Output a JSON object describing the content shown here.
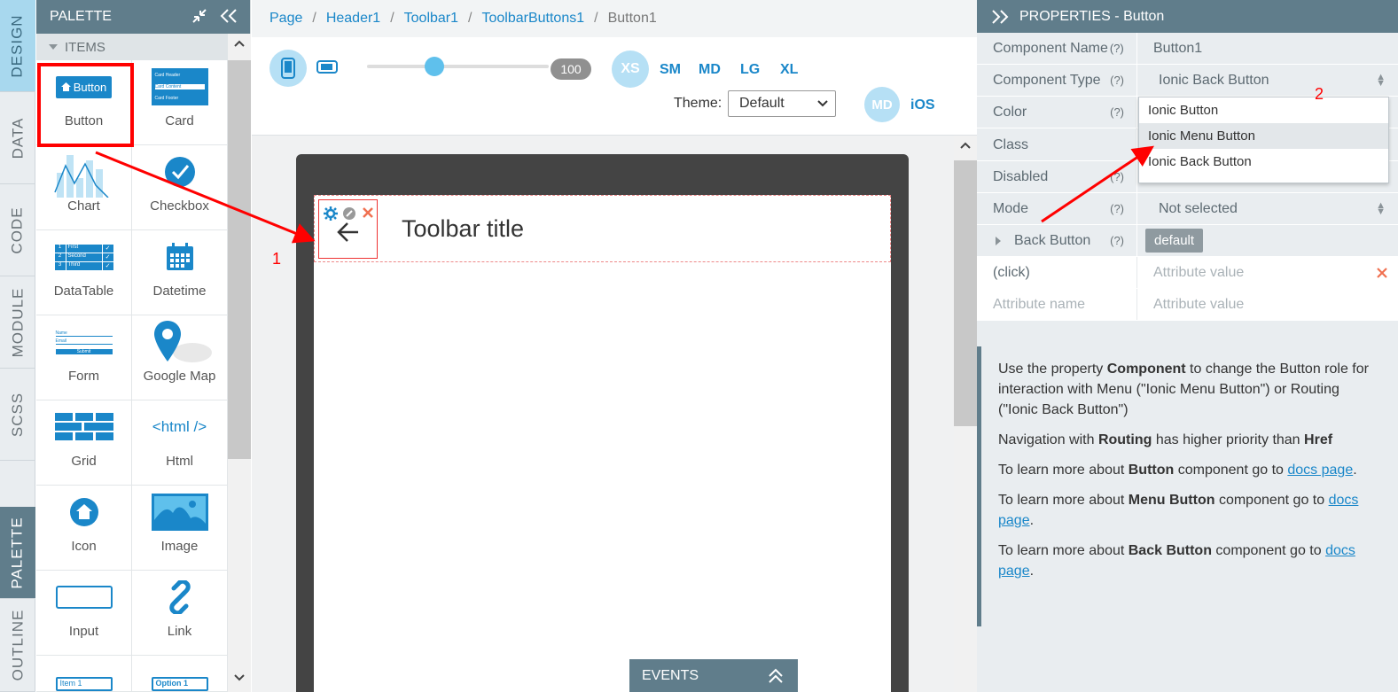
{
  "vtabs": {
    "design": "DESIGN",
    "data": "DATA",
    "code": "CODE",
    "module": "MODULE",
    "scss": "SCSS",
    "palette": "PALETTE",
    "outline": "OUTLINE"
  },
  "palette": {
    "title": "PALETTE",
    "section": "ITEMS",
    "items": [
      {
        "label": "Button",
        "icon": "button-icon"
      },
      {
        "label": "Card",
        "icon": "card-icon"
      },
      {
        "label": "Chart",
        "icon": "chart-icon"
      },
      {
        "label": "Checkbox",
        "icon": "checkbox-icon"
      },
      {
        "label": "DataTable",
        "icon": "datatable-icon"
      },
      {
        "label": "Datetime",
        "icon": "calendar-icon"
      },
      {
        "label": "Form",
        "icon": "form-icon"
      },
      {
        "label": "Google Map",
        "icon": "map-pin-icon"
      },
      {
        "label": "Grid",
        "icon": "grid-icon"
      },
      {
        "label": "Html",
        "icon": "html-icon"
      },
      {
        "label": "Icon",
        "icon": "home-icon"
      },
      {
        "label": "Image",
        "icon": "image-icon"
      },
      {
        "label": "Input",
        "icon": "input-icon"
      },
      {
        "label": "Link",
        "icon": "link-icon"
      }
    ],
    "button_icon_text": "Button",
    "card_lines": [
      "Card Header",
      "Card Content",
      "Card Footer"
    ],
    "datatable_rows": [
      [
        "1",
        "First"
      ],
      [
        "2",
        "Second"
      ],
      [
        "3",
        "Third"
      ]
    ],
    "form_lines": [
      "Name",
      "Email",
      "Submit"
    ],
    "html_text": "<html />",
    "partial_items": [
      "Item 1",
      "Option 1"
    ]
  },
  "breadcrumb": [
    "Page",
    "Header1",
    "Toolbar1",
    "ToolbarButtons1",
    "Button1"
  ],
  "toolbar": {
    "slider_value": "100",
    "breakpoints": [
      "XS",
      "SM",
      "MD",
      "LG",
      "XL"
    ],
    "theme_label": "Theme:",
    "theme_value": "Default",
    "modes": [
      "MD",
      "iOS"
    ]
  },
  "canvas": {
    "toolbar_title": "Toolbar title",
    "annotation_1": "1",
    "annotation_2": "2",
    "events_label": "EVENTS"
  },
  "properties": {
    "title": "PROPERTIES - Button",
    "help": "(?)",
    "rows": [
      {
        "label": "Component Name",
        "value": "Button1"
      },
      {
        "label": "Component Type",
        "value": "Ionic Back Button"
      },
      {
        "label": "Color",
        "value": ""
      },
      {
        "label": "Class",
        "value": ""
      },
      {
        "label": "Disabled",
        "value": ""
      },
      {
        "label": "Mode",
        "value": "Not selected"
      },
      {
        "label": "Back Button",
        "value": "default"
      }
    ],
    "click_label": "(click)",
    "attr_value_placeholder": "Attribute value",
    "attr_name_placeholder": "Attribute name",
    "dropdown_options": [
      "Ionic Button",
      "Ionic Menu Button",
      "Ionic Back Button"
    ],
    "dropdown_selected": "Ionic Menu Button",
    "info": {
      "p1_a": "Use the property ",
      "p1_b": "Component",
      "p1_c": " to change the Button role for interaction with Menu (\"Ionic Menu Button\") or Routing (\"Ionic Back Button\")",
      "p2_a": "Navigation with ",
      "p2_b": "Routing",
      "p2_c": " has higher priority than ",
      "p2_d": "Href",
      "p3_a": "To learn more about ",
      "p3_b": "Button",
      "p3_c": " component go to ",
      "p4_b": "Menu Button",
      "p5_b": "Back Button",
      "docs_link": "docs page",
      "period": "."
    }
  },
  "colors": {
    "accent": "#1a87c9",
    "header": "#607d8b",
    "highlight": "#ff0000"
  }
}
